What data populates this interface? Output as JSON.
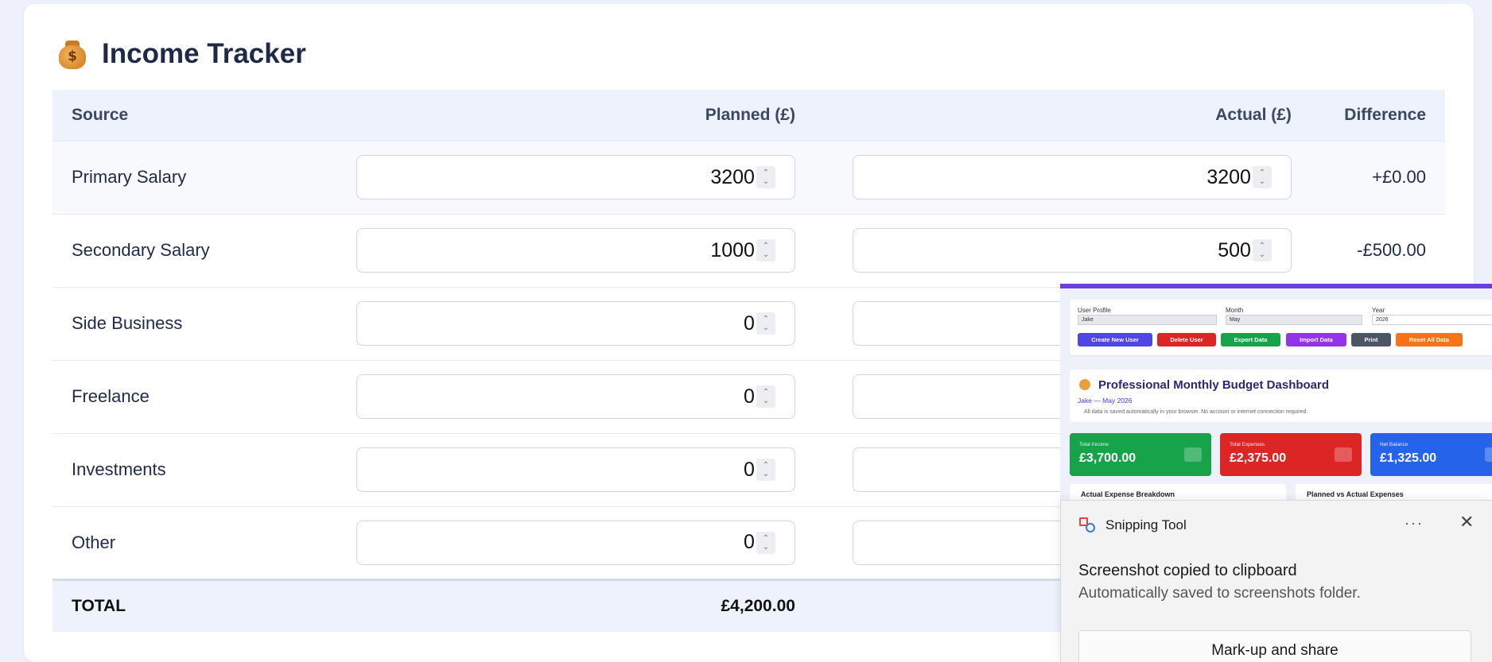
{
  "page": {
    "title": "Income Tracker",
    "title_icon": "money-bag-icon",
    "title_icon_glyph": "$"
  },
  "table": {
    "headers": {
      "source": "Source",
      "planned": "Planned (£)",
      "actual": "Actual (£)",
      "difference": "Difference"
    },
    "rows": [
      {
        "source": "Primary Salary",
        "planned": "3200",
        "actual": "3200",
        "difference": "+£0.00"
      },
      {
        "source": "Secondary Salary",
        "planned": "1000",
        "actual": "500",
        "difference": "-£500.00"
      },
      {
        "source": "Side Business",
        "planned": "0",
        "actual": "",
        "difference": ""
      },
      {
        "source": "Freelance",
        "planned": "0",
        "actual": "",
        "difference": ""
      },
      {
        "source": "Investments",
        "planned": "0",
        "actual": "",
        "difference": ""
      },
      {
        "source": "Other",
        "planned": "0",
        "actual": "",
        "difference": ""
      }
    ],
    "total": {
      "label": "TOTAL",
      "planned": "£4,200.00"
    }
  },
  "preview": {
    "labels": {
      "user": "User Profile",
      "month": "Month",
      "year": "Year"
    },
    "values": {
      "user": "Jake",
      "month": "May",
      "year": "2026"
    },
    "buttons": [
      "Create New User",
      "Delete User",
      "Export Data",
      "Import Data",
      "Print",
      "Reset All Data"
    ],
    "heading": "Professional Monthly Budget Dashboard",
    "subheading": "Jake — May 2026",
    "note": "All data is saved automatically in your browser. No account or internet connection required.",
    "cards": [
      {
        "label": "Total Income",
        "value": "£3,700.00"
      },
      {
        "label": "Total Expenses",
        "value": "£2,375.00"
      },
      {
        "label": "Net Balance",
        "value": "£1,325.00"
      }
    ],
    "panels": [
      "Actual Expense Breakdown",
      "Planned vs Actual Expenses"
    ]
  },
  "toast": {
    "app": "Snipping Tool",
    "more": "···",
    "close": "✕",
    "heading": "Screenshot copied to clipboard",
    "subtext": "Automatically saved to screenshots folder.",
    "button": "Mark-up and share"
  },
  "colors": {
    "positive": "#1fa34b",
    "negative": "#d22a2a",
    "header_bg": "#edf2fd",
    "accent_purple": "#6b3fe0"
  }
}
